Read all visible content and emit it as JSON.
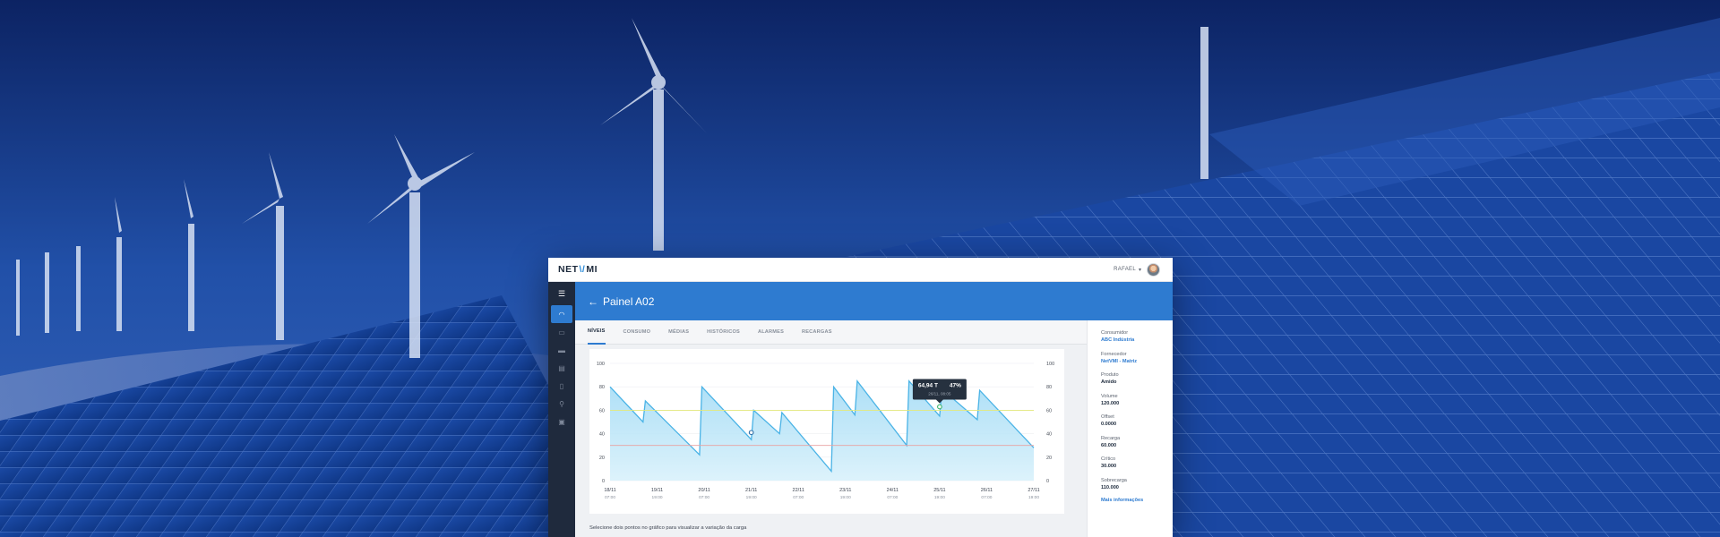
{
  "app": {
    "logo_left": "NET",
    "logo_mark": "\\/",
    "logo_right": "MI",
    "user_name": "RAFAEL",
    "caret": "▾"
  },
  "sidebar": {
    "menu_icon": "☰",
    "items": [
      {
        "icon": "gauge-icon",
        "glyph": "◠",
        "active": true
      },
      {
        "icon": "battery-icon",
        "glyph": "▭",
        "active": false
      },
      {
        "icon": "truck-icon",
        "glyph": "▬",
        "active": false
      },
      {
        "icon": "chart-icon",
        "glyph": "▤",
        "active": false
      },
      {
        "icon": "thermometer-icon",
        "glyph": "▯",
        "active": false
      },
      {
        "icon": "location-pin-icon",
        "glyph": "⚲",
        "active": false
      },
      {
        "icon": "report-icon",
        "glyph": "▣",
        "active": false
      }
    ]
  },
  "header": {
    "back_icon": "←",
    "title": "Painel A02"
  },
  "tabs": [
    "NÍVEIS",
    "CONSUMO",
    "MÉDIAS",
    "HISTÓRICOS",
    "ALARMES",
    "RECARGAS"
  ],
  "hint": "Selecione dois pontos no gráfico para visualizar a variação da carga",
  "info": {
    "items": [
      {
        "label": "Consumidor",
        "value": "ABC Indústria",
        "link": true
      },
      {
        "label": "Fornecedor",
        "value": "NetVMI - Matriz",
        "link": true
      },
      {
        "label": "Produto",
        "value": "Amido",
        "link": false
      },
      {
        "label": "Volume",
        "value": "120.000",
        "link": false
      },
      {
        "label": "Offset",
        "value": "0.0000",
        "link": false
      },
      {
        "label": "Recarga",
        "value": "60.000",
        "link": false
      },
      {
        "label": "Crítico",
        "value": "30.000",
        "link": false
      },
      {
        "label": "Sobrecarga",
        "value": "110.000",
        "link": false
      }
    ],
    "more": "Mais informações"
  },
  "chart_data": {
    "type": "area",
    "ylim": [
      0,
      100
    ],
    "y_ticks": [
      "0",
      "20",
      "40",
      "60",
      "80",
      "100"
    ],
    "x_ticks": [
      {
        "date": "18/11",
        "time": "07:00"
      },
      {
        "date": "19/11",
        "time": "19:00"
      },
      {
        "date": "20/11",
        "time": "07:00"
      },
      {
        "date": "21/11",
        "time": "19:00"
      },
      {
        "date": "22/11",
        "time": "07:00"
      },
      {
        "date": "23/11",
        "time": "19:00"
      },
      {
        "date": "24/11",
        "time": "07:00"
      },
      {
        "date": "25/11",
        "time": "19:00"
      },
      {
        "date": "26/11",
        "time": "07:00"
      },
      {
        "date": "27/11",
        "time": "19:00"
      }
    ],
    "x": [
      0,
      0.7,
      0.75,
      1.9,
      1.95,
      3.0,
      3.05,
      3.6,
      3.65,
      4.7,
      4.75,
      5.2,
      5.25,
      6.3,
      6.35,
      7.0,
      7.05,
      7.8,
      7.85,
      9.0
    ],
    "values": [
      80,
      50,
      68,
      22,
      80,
      35,
      60,
      40,
      58,
      8,
      80,
      56,
      85,
      30,
      85,
      55,
      78,
      52,
      77,
      28
    ],
    "reference_lines": [
      {
        "value": 60,
        "color": "#e3e87a"
      },
      {
        "value": 30,
        "color": "#e8a1a1"
      }
    ],
    "markers": [
      {
        "x": 3.0,
        "y": 41,
        "color": "#2e6fa8"
      },
      {
        "x": 7.0,
        "y": 63,
        "color": "#3bb36a"
      }
    ],
    "tooltip": {
      "value": "64,94 T",
      "percent": "47%",
      "timestamp": "26/11, 08:05"
    },
    "series_color": "#4ab3e6"
  }
}
